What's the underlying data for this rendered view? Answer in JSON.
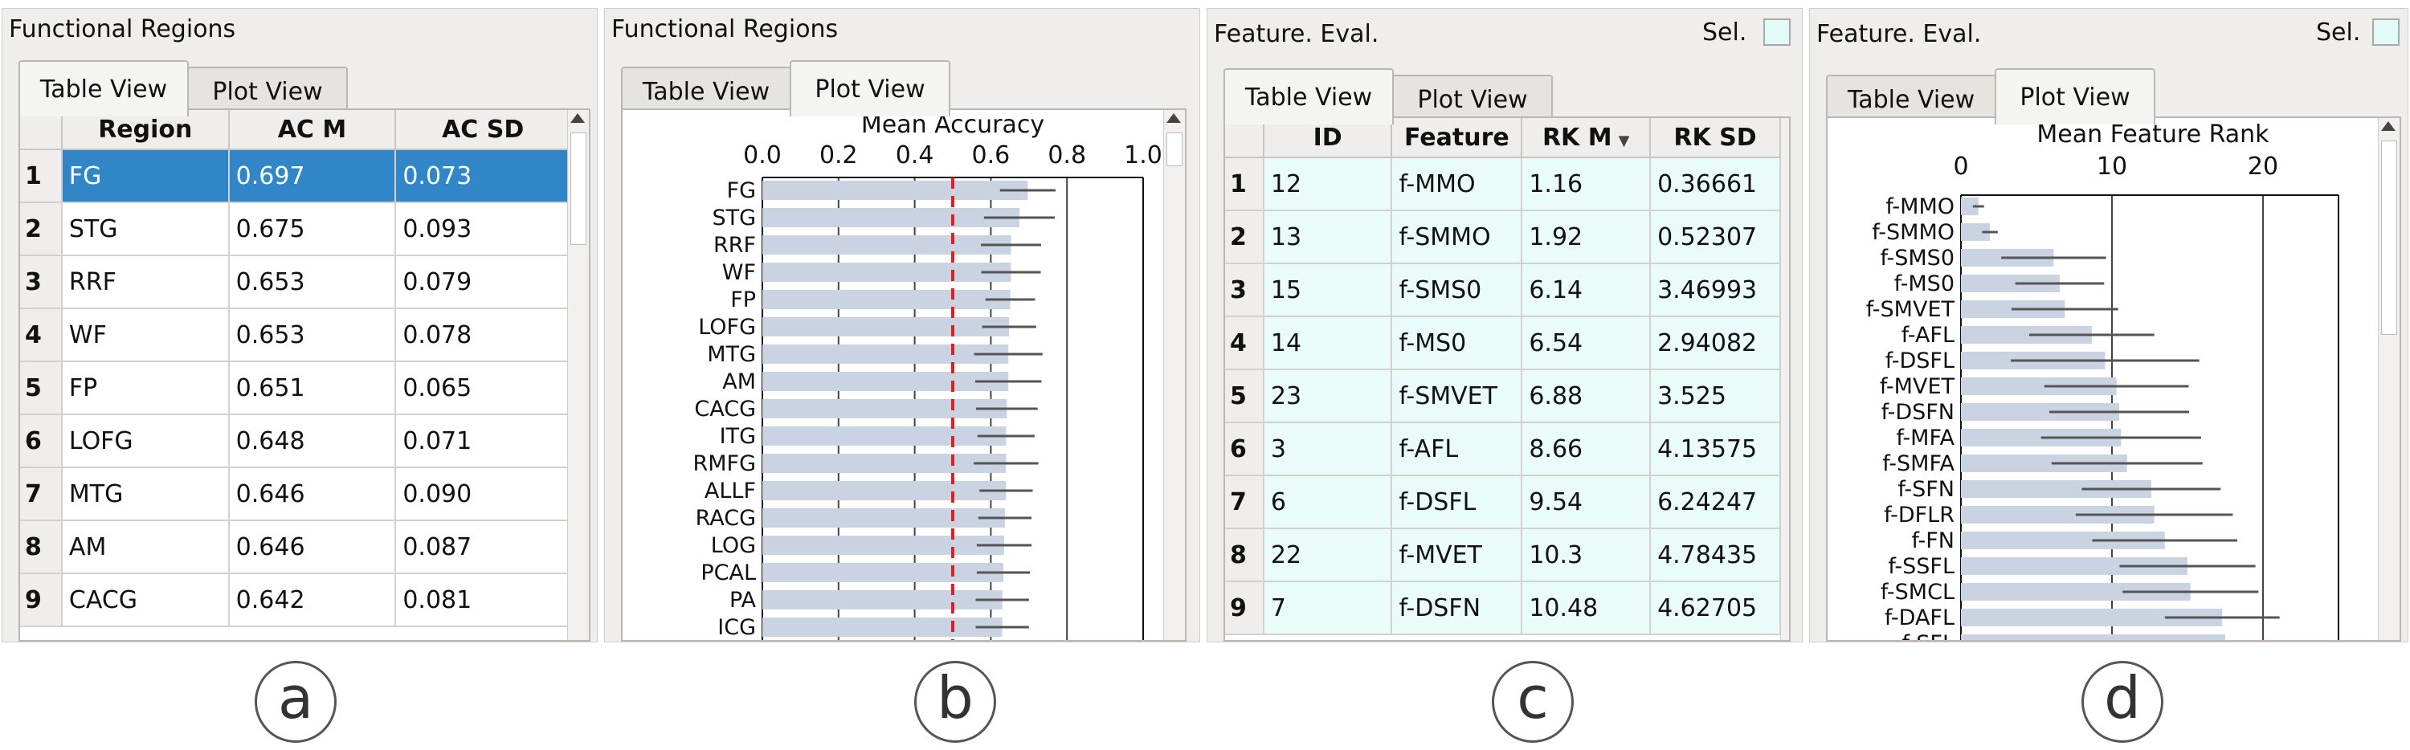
{
  "panels": {
    "a": {
      "title": "Functional Regions",
      "tabs": [
        "Table View",
        "Plot View"
      ],
      "active_tab": 0,
      "columns": [
        "Region",
        "AC M",
        "AC SD"
      ],
      "rows": [
        [
          "1",
          "FG",
          "0.697",
          "0.073"
        ],
        [
          "2",
          "STG",
          "0.675",
          "0.093"
        ],
        [
          "3",
          "RRF",
          "0.653",
          "0.079"
        ],
        [
          "4",
          "WF",
          "0.653",
          "0.078"
        ],
        [
          "5",
          "FP",
          "0.651",
          "0.065"
        ],
        [
          "6",
          "LOFG",
          "0.648",
          "0.071"
        ],
        [
          "7",
          "MTG",
          "0.646",
          "0.090"
        ],
        [
          "8",
          "AM",
          "0.646",
          "0.087"
        ],
        [
          "9",
          "CACG",
          "0.642",
          "0.081"
        ]
      ],
      "selected_row": 0
    },
    "b": {
      "title": "Functional Regions",
      "tabs": [
        "Table View",
        "Plot View"
      ],
      "active_tab": 1
    },
    "c": {
      "title": "Feature. Eval.",
      "sel_label": "Sel.",
      "tabs": [
        "Table View",
        "Plot View"
      ],
      "active_tab": 0,
      "columns": [
        "ID",
        "Feature",
        "RK M",
        "RK SD"
      ],
      "sort_column": "RK M",
      "rows": [
        [
          "1",
          "12",
          "f-MMO",
          "1.16",
          "0.36661"
        ],
        [
          "2",
          "13",
          "f-SMMO",
          "1.92",
          "0.52307"
        ],
        [
          "3",
          "15",
          "f-SMS0",
          "6.14",
          "3.46993"
        ],
        [
          "4",
          "14",
          "f-MS0",
          "6.54",
          "2.94082"
        ],
        [
          "5",
          "23",
          "f-SMVET",
          "6.88",
          "3.525"
        ],
        [
          "6",
          "3",
          "f-AFL",
          "8.66",
          "4.13575"
        ],
        [
          "7",
          "6",
          "f-DSFL",
          "9.54",
          "6.24247"
        ],
        [
          "8",
          "22",
          "f-MVET",
          "10.3",
          "4.78435"
        ],
        [
          "9",
          "7",
          "f-DSFN",
          "10.48",
          "4.62705"
        ]
      ]
    },
    "d": {
      "title": "Feature. Eval.",
      "sel_label": "Sel.",
      "tabs": [
        "Table View",
        "Plot View"
      ],
      "active_tab": 1
    }
  },
  "captions": [
    "a",
    "b",
    "c",
    "d"
  ],
  "colors": {
    "bar": "#c9d3e1",
    "selection": "#3186c8",
    "threshold": "#e02020",
    "row_tint": "#e9fcfa"
  },
  "chart_data": [
    {
      "type": "bar",
      "orientation": "horizontal",
      "title": "Mean Accuracy",
      "xlim": [
        0.0,
        1.0
      ],
      "xticks": [
        "0.0",
        "0.2",
        "0.4",
        "0.6",
        "0.8",
        "1.0"
      ],
      "grid": true,
      "reference_line": 0.5,
      "categories": [
        "FG",
        "STG",
        "RRF",
        "WF",
        "FP",
        "LOFG",
        "MTG",
        "AM",
        "CACG",
        "ITG",
        "RMFG",
        "ALLF",
        "RACG",
        "LOG",
        "PCAL",
        "PA",
        "ICG"
      ],
      "values": [
        0.697,
        0.675,
        0.653,
        0.653,
        0.651,
        0.648,
        0.646,
        0.646,
        0.642,
        0.64,
        0.64,
        0.64,
        0.637,
        0.635,
        0.633,
        0.63,
        0.63
      ],
      "error": [
        0.073,
        0.093,
        0.079,
        0.078,
        0.065,
        0.071,
        0.09,
        0.087,
        0.081,
        0.075,
        0.085,
        0.07,
        0.07,
        0.072,
        0.07,
        0.07,
        0.07
      ]
    },
    {
      "type": "bar",
      "orientation": "horizontal",
      "title": "Mean Feature Rank",
      "xlim": [
        0,
        25
      ],
      "xticks": [
        "0",
        "10",
        "20"
      ],
      "grid": true,
      "categories": [
        "f-MMO",
        "f-SMMO",
        "f-SMS0",
        "f-MS0",
        "f-SMVET",
        "f-AFL",
        "f-DSFL",
        "f-MVET",
        "f-DSFN",
        "f-MFA",
        "f-SMFA",
        "f-SFN",
        "f-DFLR",
        "f-FN",
        "f-SSFL",
        "f-SMCL",
        "f-DAFL",
        "f-SFL"
      ],
      "values": [
        1.16,
        1.92,
        6.14,
        6.54,
        6.88,
        8.66,
        9.54,
        10.3,
        10.48,
        10.6,
        11.0,
        12.6,
        12.8,
        13.5,
        15.0,
        15.2,
        17.3,
        17.5
      ],
      "error": [
        0.37,
        0.52,
        3.47,
        2.94,
        3.53,
        4.14,
        6.24,
        4.78,
        4.63,
        5.3,
        5.0,
        4.6,
        5.2,
        4.8,
        4.5,
        4.5,
        3.8,
        3.8
      ]
    }
  ]
}
